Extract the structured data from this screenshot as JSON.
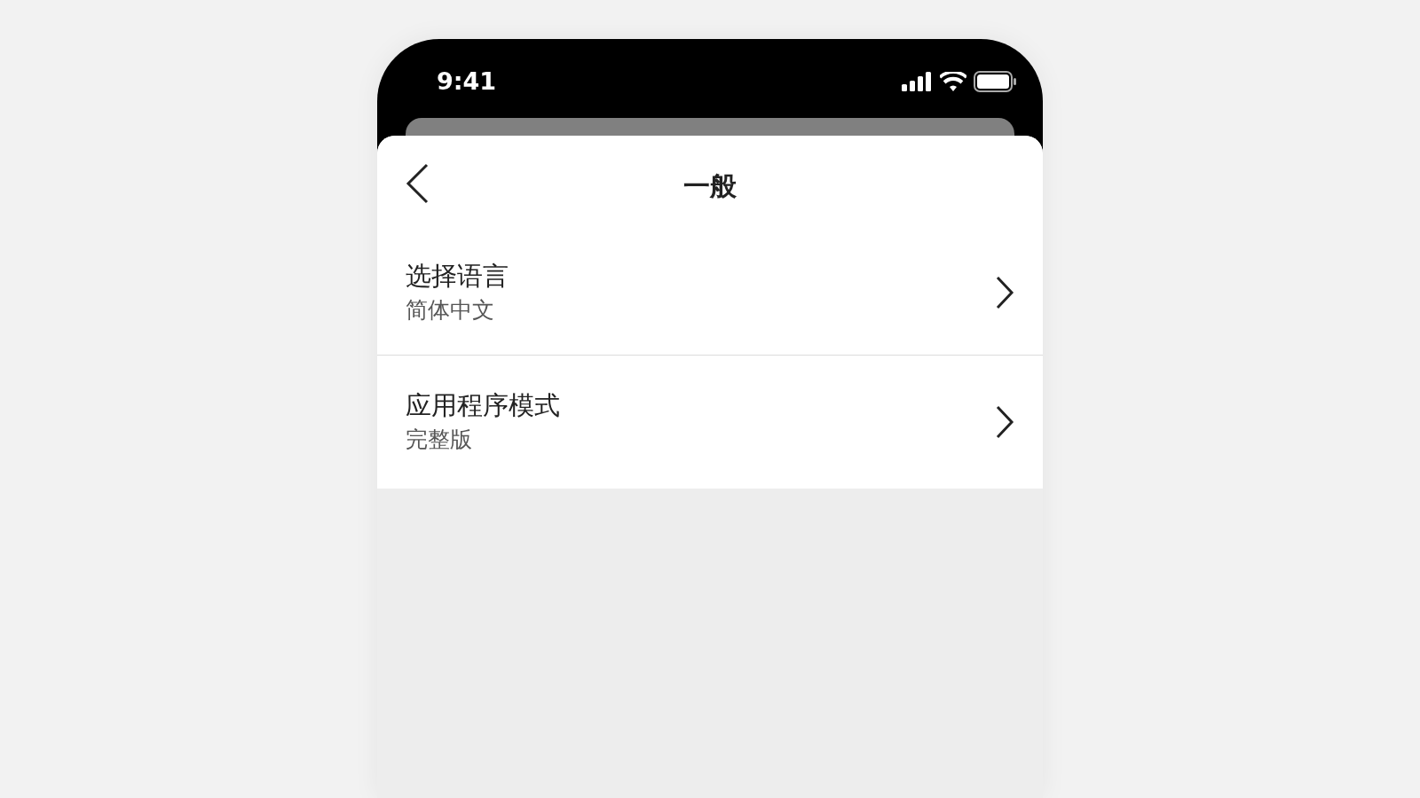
{
  "status_bar": {
    "time": "9:41"
  },
  "header": {
    "title": "一般"
  },
  "settings": [
    {
      "title": "选择语言",
      "value": "简体中文"
    },
    {
      "title": "应用程序模式",
      "value": "完整版"
    }
  ]
}
